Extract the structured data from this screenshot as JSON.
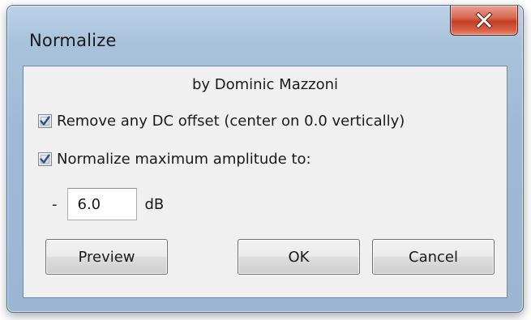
{
  "window": {
    "title": "Normalize",
    "close_icon": "close-x-icon"
  },
  "content": {
    "credit": "by Dominic Mazzoni",
    "remove_dc": {
      "label": "Remove any DC offset (center on 0.0 vertically)",
      "checked": true
    },
    "normalize_max": {
      "label": "Normalize maximum amplitude to:",
      "checked": true
    },
    "amplitude": {
      "sign": "-",
      "value": "6.0",
      "unit": "dB"
    }
  },
  "buttons": {
    "preview": "Preview",
    "ok": "OK",
    "cancel": "Cancel"
  },
  "colors": {
    "check_mark": "#2c4f8c",
    "close_button": "#c43e22",
    "frame": "#a9c3dc"
  }
}
